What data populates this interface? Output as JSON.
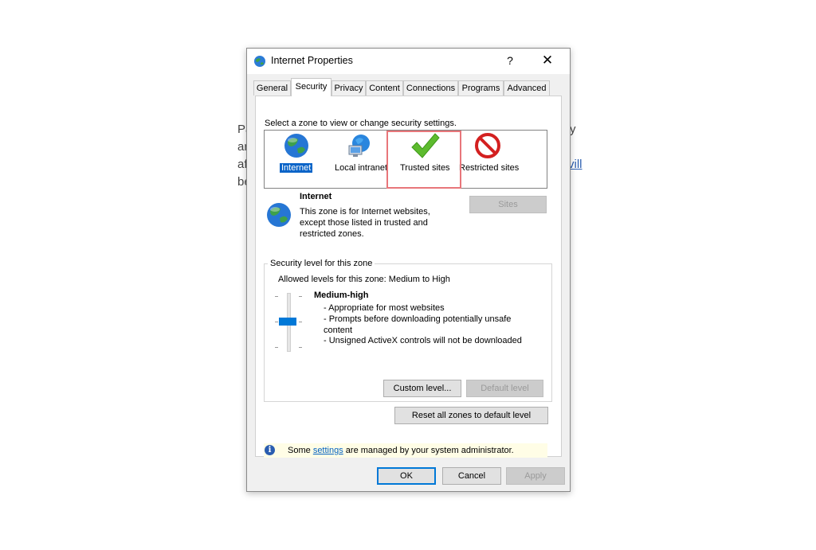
{
  "background": {
    "left_fragments": [
      "Pa",
      "ar",
      "af",
      "be"
    ],
    "right_fragments": [
      "y",
      "vill"
    ]
  },
  "dialog": {
    "title": "Internet Properties",
    "help": "?",
    "close": "✕",
    "tabs": [
      "General",
      "Security",
      "Privacy",
      "Content",
      "Connections",
      "Programs",
      "Advanced"
    ],
    "active_tab": "Security"
  },
  "security": {
    "zone_prompt": "Select a zone to view or change security settings.",
    "zones": [
      {
        "label": "Internet",
        "icon": "globe-icon",
        "selected": true
      },
      {
        "label": "Local intranet",
        "icon": "network-icon",
        "selected": false
      },
      {
        "label": "Trusted sites",
        "icon": "checkmark-icon",
        "selected": false
      },
      {
        "label": "Restricted sites",
        "icon": "no-entry-icon",
        "selected": false
      }
    ],
    "zone_info": {
      "name": "Internet",
      "description_lines": [
        "This zone is for Internet websites,",
        "except those listed in trusted and",
        "restricted zones."
      ]
    },
    "sites_button": "Sites",
    "level_group_title": "Security level for this zone",
    "allowed_levels": "Allowed levels for this zone: Medium to High",
    "level_name": "Medium-high",
    "level_details": [
      "- Appropriate for most websites",
      "- Prompts before downloading potentially unsafe",
      "content",
      "- Unsigned ActiveX controls will not be downloaded"
    ],
    "custom_level_button": "Custom level...",
    "default_level_button": "Default level",
    "reset_button": "Reset all zones to default level",
    "info_prefix": "Some",
    "info_link": "settings",
    "info_suffix": "are managed by your system administrator."
  },
  "footer": {
    "ok": "OK",
    "cancel": "Cancel",
    "apply": "Apply"
  },
  "colors": {
    "highlight_border": "#e8767a",
    "selection": "#0a64c8",
    "accent": "#0078d7",
    "info_bar": "#fffde6"
  }
}
